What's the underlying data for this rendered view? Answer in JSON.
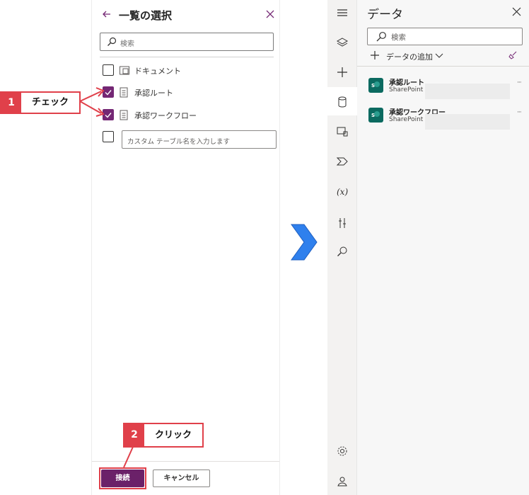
{
  "left_panel": {
    "title": "一覧の選択",
    "search_placeholder": "検索",
    "items": [
      {
        "label": "ドキュメント",
        "checked": false
      },
      {
        "label": "承認ルート",
        "checked": true
      },
      {
        "label": "承認ワークフロー",
        "checked": true
      }
    ],
    "custom_placeholder": "カスタム テーブル名を入力します",
    "connect_label": "接続",
    "cancel_label": "キャンセル"
  },
  "callouts": [
    {
      "number": "1",
      "text": "チェック"
    },
    {
      "number": "2",
      "text": "クリック"
    }
  ],
  "data_panel": {
    "title": "データ",
    "search_placeholder": "検索",
    "add_data_label": "データの追加",
    "sources": [
      {
        "name": "承認ルート",
        "subtitle": "SharePoint -"
      },
      {
        "name": "承認ワークフロー",
        "subtitle": "SharePoint -"
      }
    ]
  },
  "colors": {
    "accent": "#742774",
    "callout": "#e0404a",
    "arrow": "#2f80ed",
    "sharepoint": "#0b6a60"
  }
}
